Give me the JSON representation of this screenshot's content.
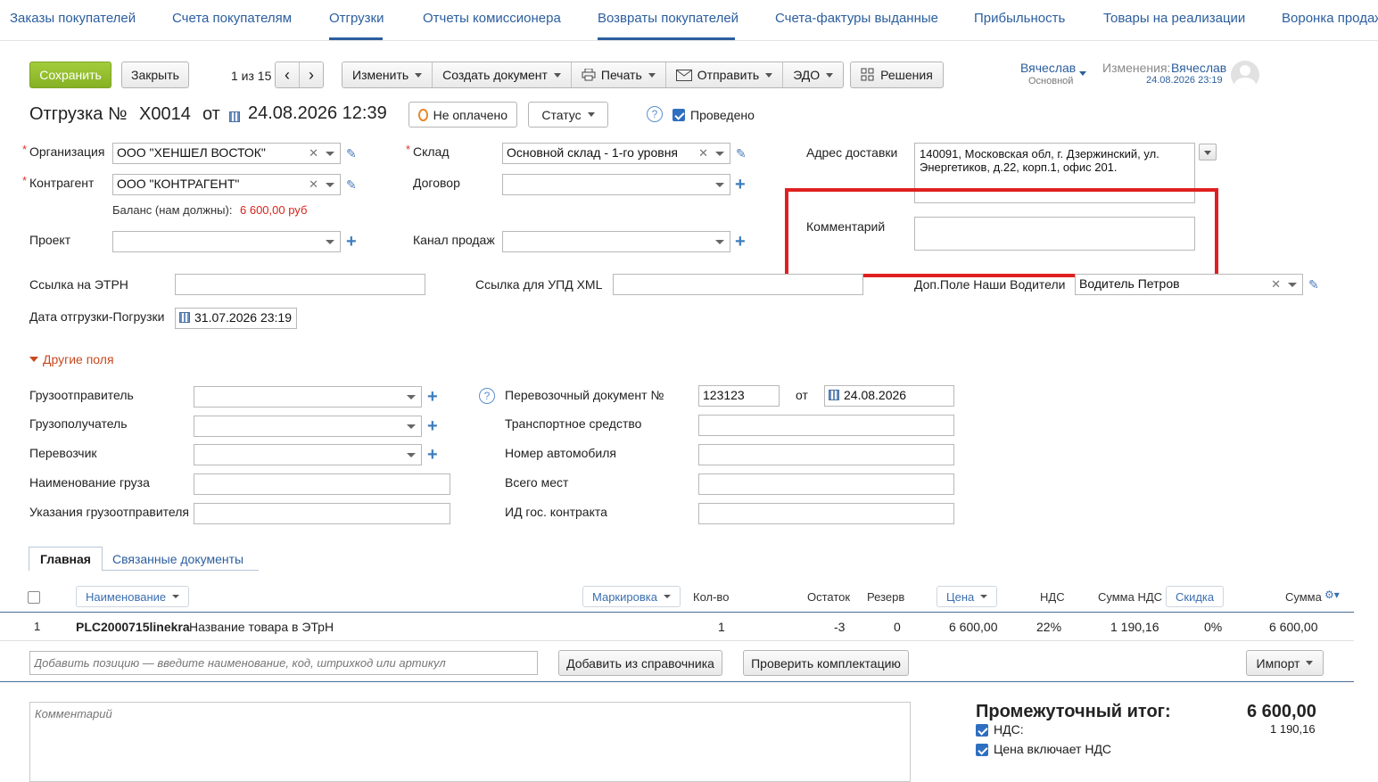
{
  "nav": {
    "tabs": [
      "Заказы покупателей",
      "Счета покупателям",
      "Отгрузки",
      "Отчеты комиссионера",
      "Возвраты покупателей",
      "Счета-фактуры выданные",
      "Прибыльность",
      "Товары на реализации",
      "Воронка продаж"
    ]
  },
  "toolbar": {
    "save": "Сохранить",
    "close": "Закрыть",
    "pager": "1 из 15",
    "prev": "‹",
    "next": "›",
    "edit": "Изменить",
    "create_doc": "Создать документ",
    "print": "Печать",
    "send": "Отправить",
    "edo": "ЭДО",
    "solutions": "Решения"
  },
  "user": {
    "name": "Вячеслав",
    "role": "Основной",
    "changes_label": "Изменения:",
    "changes_user": "Вячеслав",
    "changes_date": "24.08.2026 23:19"
  },
  "doc": {
    "title_prefix": "Отгрузка №",
    "number": "Х0014",
    "from": "от",
    "date": "24.08.2026 12:39",
    "payment_status": "Не оплачено",
    "status": "Статус",
    "posted": "Проведено"
  },
  "form": {
    "org_label": "Организация",
    "org_value": "ООО \"ХЕНШЕЛ ВОСТОК\"",
    "counterparty_label": "Контрагент",
    "counterparty_value": "ООО \"КОНТРАГЕНТ\"",
    "balance_label": "Баланс (нам должны):",
    "balance_value": "6 600,00 руб",
    "project_label": "Проект",
    "warehouse_label": "Склад",
    "warehouse_value": "Основной склад - 1-го уровня",
    "contract_label": "Договор",
    "channel_label": "Канал продаж",
    "address_label": "Адрес доставки",
    "address_value": "140091, Московская обл, г. Дзержинский,  ул. Энергетиков, д.22, корп.1, офис 201.",
    "comment_label": "Комментарий",
    "etrn_label": "Ссылка на ЭТРН",
    "upd_label": "Ссылка для УПД XML",
    "drivers_label": "Доп.Поле Наши Водители",
    "drivers_value": "Водитель Петров",
    "ship_date_label": "Дата отгрузки-Погрузки",
    "ship_date_value": "31.07.2026 23:19",
    "other_fields": "Другие поля"
  },
  "other": {
    "shipper": "Грузоотправитель",
    "consignee": "Грузополучатель",
    "carrier": "Перевозчик",
    "cargo_name": "Наименование груза",
    "shipper_notes": "Указания грузоотправителя",
    "transport_doc_label": "Перевозочный документ №",
    "transport_doc_value": "123123",
    "from": "от",
    "transport_doc_date": "24.08.2026",
    "vehicle": "Транспортное средство",
    "car_number": "Номер автомобиля",
    "places": "Всего мест",
    "contract_id": "ИД гос. контракта"
  },
  "tabs": {
    "main": "Главная",
    "related": "Связанные документы"
  },
  "table": {
    "headers": {
      "name": "Наименование",
      "marking": "Маркировка",
      "qty": "Кол-во",
      "stock": "Остаток",
      "reserve": "Резерв",
      "price": "Цена",
      "vat": "НДС",
      "vat_sum": "Сумма НДС",
      "discount": "Скидка",
      "sum": "Сумма"
    },
    "rows": [
      {
        "num": "1",
        "code": "PLC2000715linekra",
        "name": "Название товара в ЭТрН",
        "qty": "1",
        "stock": "-3",
        "reserve": "0",
        "price": "6 600,00",
        "vat": "22%",
        "vat_sum": "1 190,16",
        "discount": "0%",
        "sum": "6 600,00"
      }
    ],
    "add_placeholder": "Добавить позицию — введите наименование, код, штрихкод или артикул",
    "add_from_catalog": "Добавить из справочника",
    "check_kit": "Проверить комплектацию",
    "import": "Импорт"
  },
  "footer": {
    "comment_placeholder": "Комментарий",
    "subtotal_label": "Промежуточный итог:",
    "subtotal_value": "6 600,00",
    "vat_label": "НДС:",
    "vat_value": "1 190,16",
    "price_incl_vat": "Цена включает НДС"
  },
  "colors": {
    "accent": "#2b5e9e",
    "save_green": "#8fba2b",
    "highlight_red": "#e02020",
    "balance_red": "#d9241c"
  }
}
